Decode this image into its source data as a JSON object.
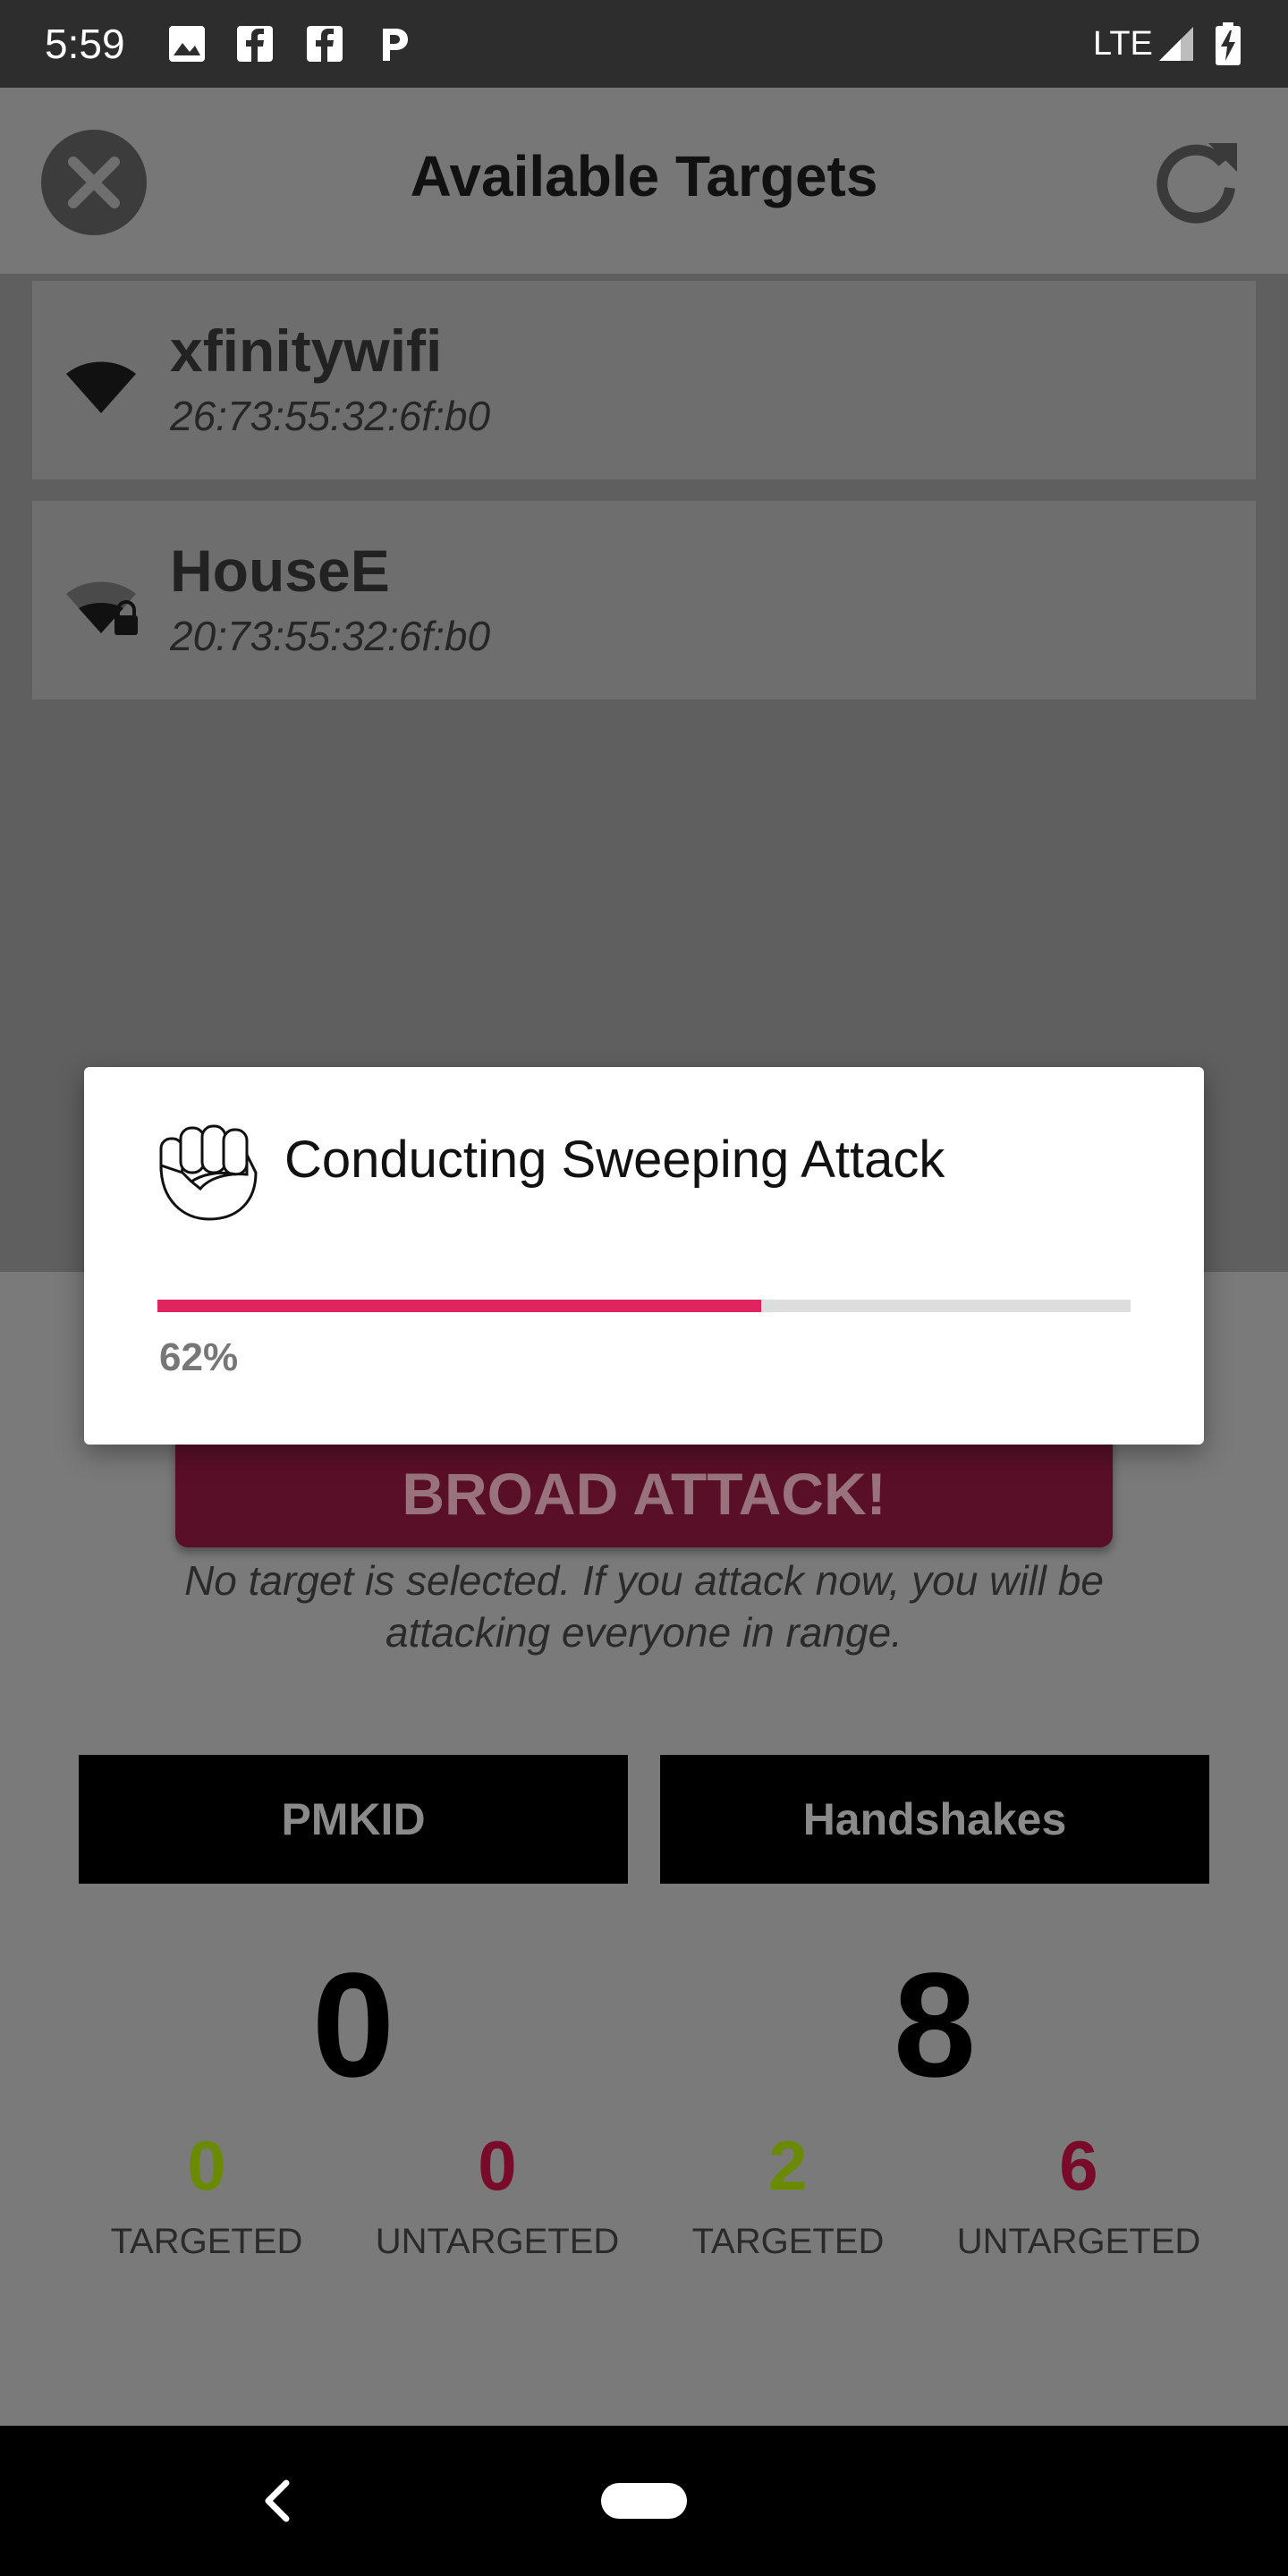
{
  "status_bar": {
    "time": "5:59",
    "network": "LTE",
    "icons": [
      "image-icon",
      "facebook-icon",
      "facebook-icon",
      "pandora-icon",
      "signal-icon",
      "battery-charging-icon"
    ]
  },
  "app_bar": {
    "title": "Available Targets",
    "close_icon": "close-icon",
    "refresh_icon": "refresh-icon"
  },
  "networks": [
    {
      "ssid": "xfinitywifi",
      "bssid": "26:73:55:32:6f:b0",
      "secured": false,
      "icon": "wifi-icon"
    },
    {
      "ssid": "HouseE",
      "bssid": "20:73:55:32:6f:b0",
      "secured": true,
      "icon": "wifi-lock-icon"
    }
  ],
  "attack": {
    "button_label": "BROAD ATTACK!",
    "note": "No target is selected. If you attack now, you will be attacking everyone in range."
  },
  "tabs": {
    "pmkid_label": "PMKID",
    "handshakes_label": "Handshakes"
  },
  "stats": {
    "pmkid_total": "0",
    "handshakes_total": "8",
    "pmkid_targeted": "0",
    "pmkid_untargeted": "0",
    "handshakes_targeted": "2",
    "handshakes_untargeted": "6",
    "targeted_label": "TARGETED",
    "untargeted_label": "UNTARGETED"
  },
  "dialog": {
    "title": "Conducting Sweeping Attack",
    "icon": "fist-icon",
    "progress": 0.62,
    "progress_text": "62%"
  },
  "colors": {
    "accent": "#e0245e",
    "targeted": "#6a8a00",
    "untargeted": "#7a0a2a"
  }
}
